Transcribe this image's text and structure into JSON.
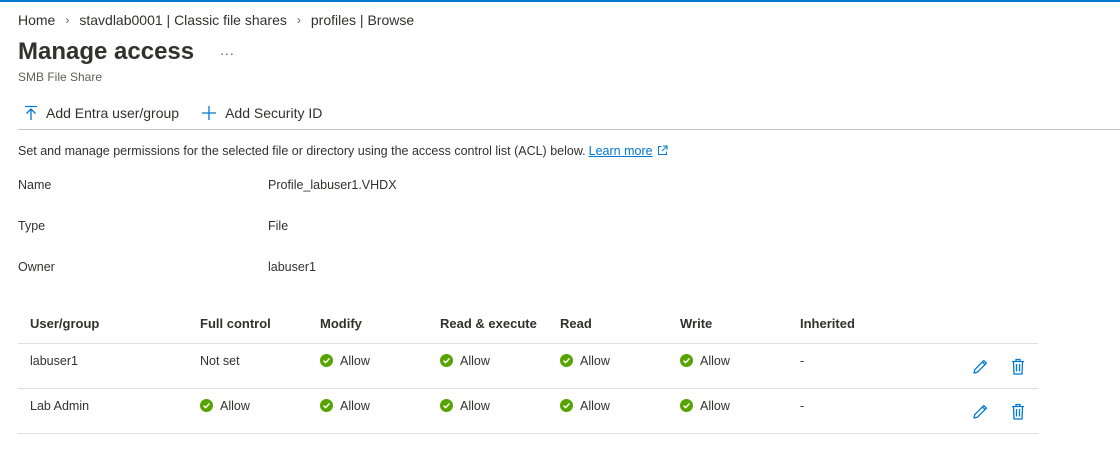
{
  "colors": {
    "accent": "#0078d4",
    "success": "#57a300"
  },
  "breadcrumb": [
    "Home",
    "stavdlab0001 | Classic file shares",
    "profiles | Browse"
  ],
  "page": {
    "title": "Manage access",
    "more": "...",
    "subtitle": "SMB File Share"
  },
  "toolbar": {
    "add_entra": "Add Entra user/group",
    "add_sid": "Add Security ID"
  },
  "description": {
    "text": "Set and manage permissions for the selected file or directory using the access control list (ACL) below.",
    "link": "Learn more"
  },
  "properties": [
    {
      "label": "Name",
      "value": "Profile_labuser1.VHDX"
    },
    {
      "label": "Type",
      "value": "File"
    },
    {
      "label": "Owner",
      "value": "labuser1"
    }
  ],
  "acl": {
    "columns": [
      "User/group",
      "Full control",
      "Modify",
      "Read & execute",
      "Read",
      "Write",
      "Inherited"
    ],
    "rows": [
      {
        "user": "labuser1",
        "full_control": "Not set",
        "modify": "Allow",
        "read_execute": "Allow",
        "read": "Allow",
        "write": "Allow",
        "inherited": "-"
      },
      {
        "user": "Lab Admin",
        "full_control": "Allow",
        "modify": "Allow",
        "read_execute": "Allow",
        "read": "Allow",
        "write": "Allow",
        "inherited": "-"
      }
    ]
  }
}
